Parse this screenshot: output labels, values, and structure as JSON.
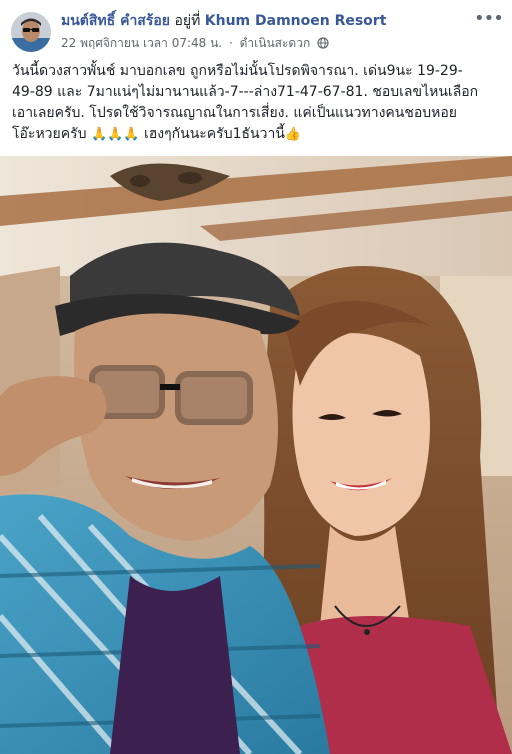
{
  "post": {
    "author_name": "มนต์สิทธิ์ คำสร้อย",
    "location_prefix": "อยู่ที่",
    "location_name": "Khum Damnoen Resort",
    "timestamp": "22 พฤศจิกายน เวลา 07:48 น.",
    "separator": "·",
    "activity": "ดำเนินสะดวก",
    "audience_icon": "globe-icon",
    "more_icon": "ellipsis-icon",
    "more_label": "•••",
    "text_lines": [
      "วันนี้ดวงสาวพั้นช์ มาบอกเลข ถูกหรือไม่นั้นโปรดพิจารณา. เด่น9นะ 19-29-",
      "49-89 และ 7มาแน่ๆไม่มานานแล้ว-7---ล่าง71-47-67-81. ชอบเลขไหนเลือก",
      "เอาเลยครับ. โปรดใช้วิจารณญาณในการเสี่ยง. แค่เป็นแนวทางคนชอบหอย",
      "โอ๊ะหวยครับ ",
      " เฮงๆกันนะครับ1ธันวานี้"
    ],
    "emoji_pray": "🙏🙏🙏",
    "emoji_thumb": "👍",
    "photo_alt": "selfie-photo"
  },
  "colors": {
    "link": "#385898",
    "text": "#1d2129",
    "meta": "#616770"
  }
}
